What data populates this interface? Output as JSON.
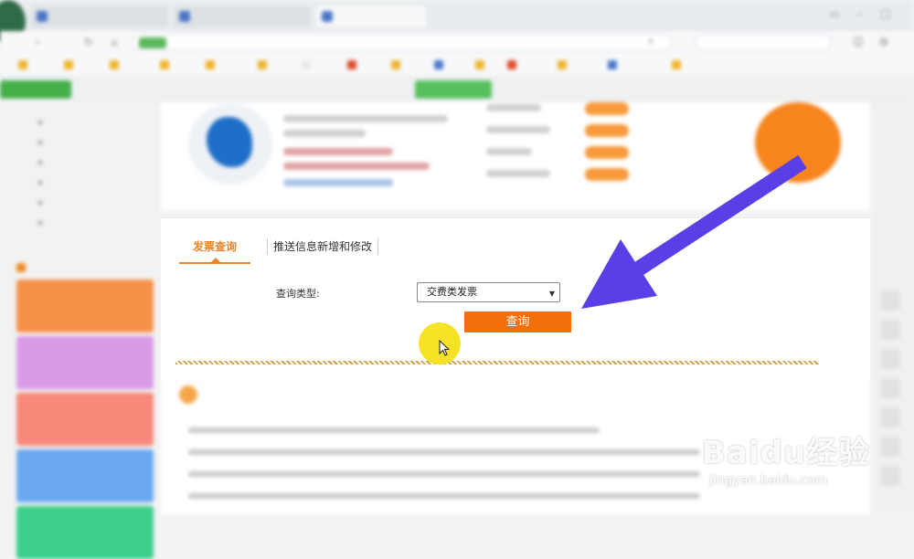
{
  "browser": {
    "tabs": [
      "",
      "",
      ""
    ],
    "url": "",
    "search_placeholder": "",
    "bookmarks": [
      "",
      "",
      "",
      "",
      "",
      "",
      "",
      "",
      "",
      "",
      "",
      "",
      "",
      "",
      "",
      ""
    ],
    "subnav": [
      "",
      "",
      "",
      "",
      ""
    ]
  },
  "sidebar": {
    "links": [
      "",
      "",
      "",
      "",
      "",
      ""
    ],
    "section_title": "",
    "cards": [
      {
        "color": "#f6914a"
      },
      {
        "color": "#d99ae6"
      },
      {
        "color": "#f8887a"
      },
      {
        "color": "#6aa7f2"
      },
      {
        "color": "#3ccf8a"
      }
    ]
  },
  "profile": {
    "button_label": ""
  },
  "tabs": {
    "invoice_query": "发票查询",
    "push_info": "推送信息新增和修改"
  },
  "form": {
    "query_type_label": "查询类型:",
    "query_type_value": "交费类发票",
    "submit_label": "查询"
  },
  "lower": {
    "heading": ""
  },
  "watermark": {
    "brand": "Baidu",
    "brand_cn": "经验",
    "url": "jingyan.baidu.com"
  },
  "colors": {
    "accent": "#e8852b",
    "button": "#f26f0c",
    "arrow": "#5a3fe6",
    "cursor_highlight": "#f7e21a"
  }
}
